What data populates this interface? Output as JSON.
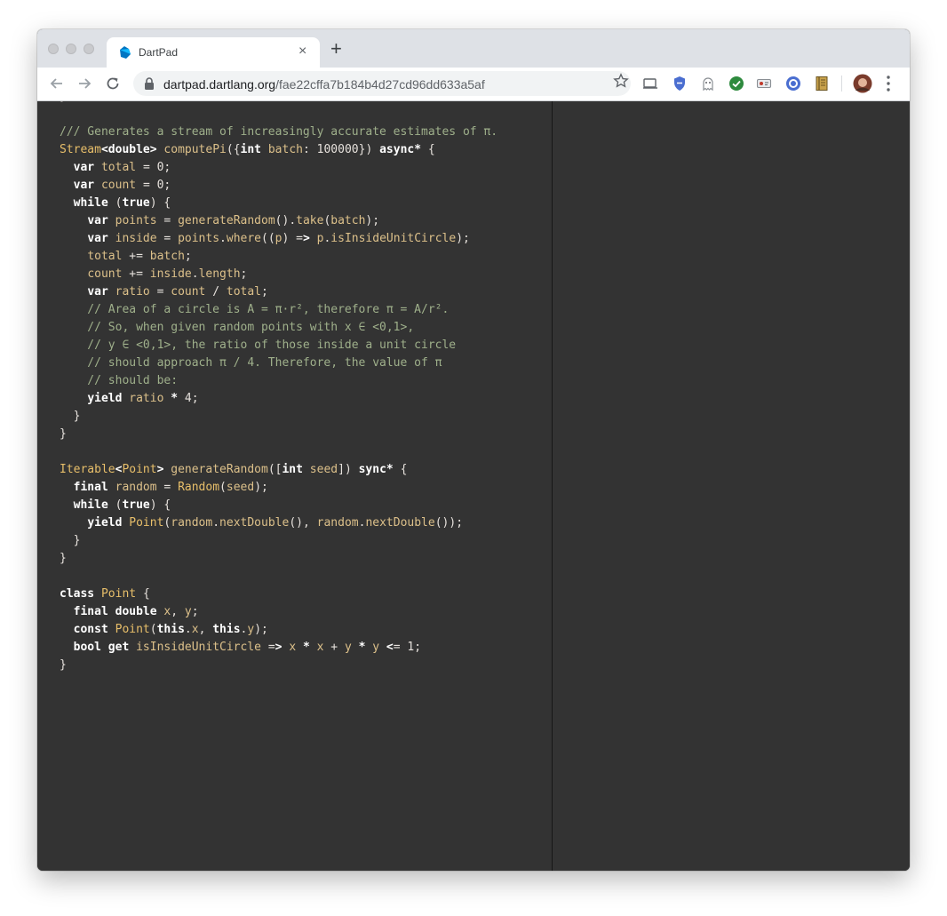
{
  "browser": {
    "tab_title": "DartPad",
    "tab_close": "×",
    "new_tab": "+",
    "url_host": "dartpad.dartlang.org",
    "url_path": "/fae22cffa7b184b4d27cd96dd633a5af",
    "accent": "#1a73e8"
  },
  "editor": {
    "background": "#333333",
    "lines": [
      "}",
      "",
      "/// Generates a stream of increasingly accurate estimates of π.",
      "Stream<double> computePi({int batch: 100000}) async* {",
      "  var total = 0;",
      "  var count = 0;",
      "  while (true) {",
      "    var points = generateRandom().take(batch);",
      "    var inside = points.where((p) => p.isInsideUnitCircle);",
      "    total += batch;",
      "    count += inside.length;",
      "    var ratio = count / total;",
      "    // Area of a circle is A = π·r², therefore π = A/r².",
      "    // So, when given random points with x ∈ <0,1>,",
      "    // y ∈ <0,1>, the ratio of those inside a unit circle",
      "    // should approach π / 4. Therefore, the value of π",
      "    // should be:",
      "    yield ratio * 4;",
      "  }",
      "}",
      "",
      "Iterable<Point> generateRandom([int seed]) sync* {",
      "  final random = Random(seed);",
      "  while (true) {",
      "    yield Point(random.nextDouble(), random.nextDouble());",
      "  }",
      "}",
      "",
      "class Point {",
      "  final double x, y;",
      "  const Point(this.x, this.y);",
      "  bool get isInsideUnitCircle => x * x + y * y <= 1;",
      "}"
    ]
  }
}
